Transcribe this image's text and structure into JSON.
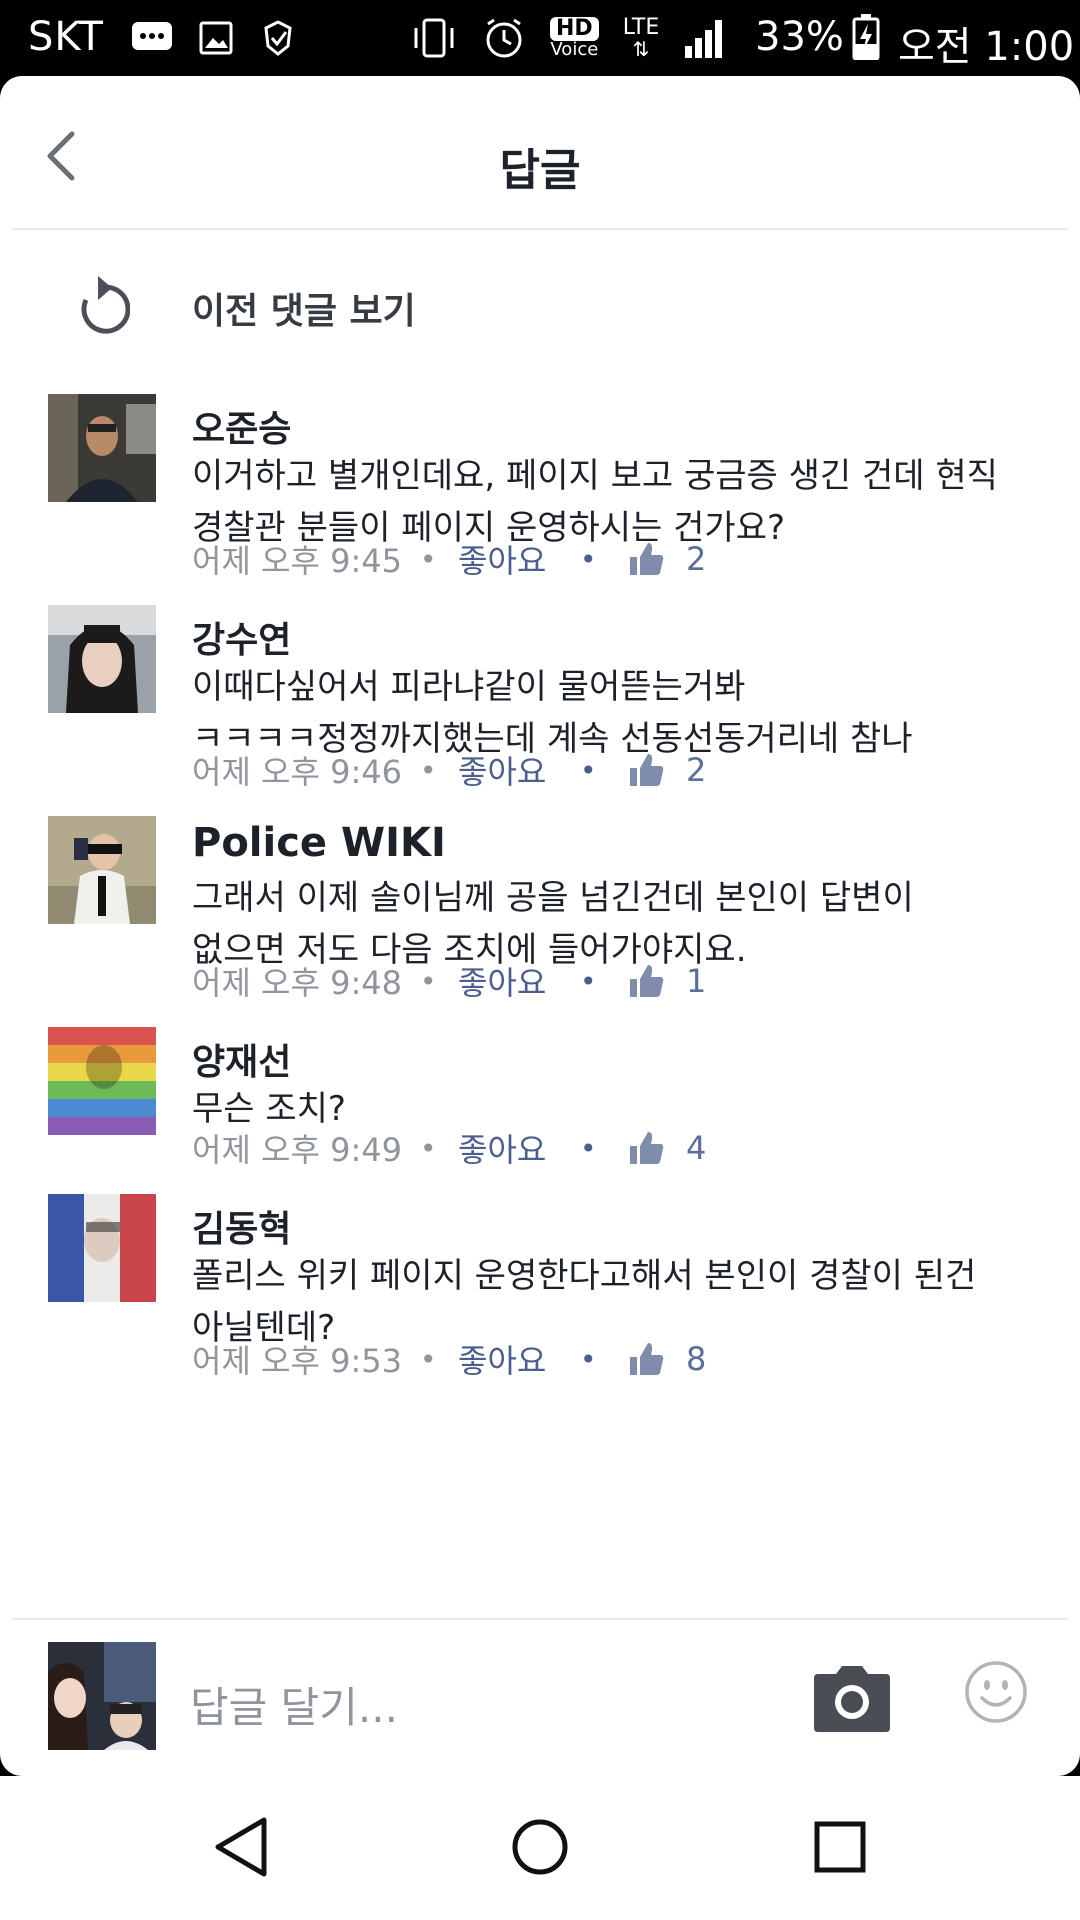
{
  "status_bar": {
    "carrier": "SKT",
    "battery": "33%",
    "time": "오전 1:00",
    "icons": [
      "message-icon",
      "image-icon",
      "shield-icon",
      "vibrate-icon",
      "alarm-icon",
      "hd-voice-icon",
      "lte-icon",
      "signal-icon",
      "battery-charging-icon"
    ],
    "hd_label": "HD",
    "voice_label": "Voice",
    "lte_label": "LTE"
  },
  "header": {
    "title": "답글"
  },
  "previous": {
    "label": "이전 댓글 보기"
  },
  "comments": [
    {
      "name": "오준승",
      "lines": [
        "이거하고 별개인데요, 페이지 보고 궁금증 생긴 건데 현직",
        "경찰관 분들이 페이지 운영하시는 건가요?"
      ],
      "time": "어제 오후 9:45",
      "like_label": "좋아요",
      "likes": "2"
    },
    {
      "name": "강수연",
      "lines": [
        "이때다싶어서 피라냐같이 물어뜯는거봐",
        "ㅋㅋㅋㅋ정정까지했는데 계속 선동선동거리네 참나"
      ],
      "time": "어제 오후 9:46",
      "like_label": "좋아요",
      "likes": "2"
    },
    {
      "name": "Police WIKI",
      "lines": [
        "그래서 이제 솔이님께 공을 넘긴건데 본인이 답변이",
        "없으면 저도 다음 조치에 들어가야지요."
      ],
      "time": "어제 오후 9:48",
      "like_label": "좋아요",
      "likes": "1"
    },
    {
      "name": "양재선",
      "lines": [
        "무슨 조치?"
      ],
      "time": "어제 오후 9:49",
      "like_label": "좋아요",
      "likes": "4"
    },
    {
      "name": "김동혁",
      "lines": [
        "폴리스 위키 페이지 운영한다고해서 본인이 경찰이 된건",
        "아닐텐데?"
      ],
      "time": "어제 오후 9:53",
      "like_label": "좋아요",
      "likes": "8"
    }
  ],
  "composer": {
    "placeholder": "답글 달기..."
  },
  "colors": {
    "accent": "#4b5e8e",
    "meta": "#90949c",
    "text": "#1d2129"
  }
}
